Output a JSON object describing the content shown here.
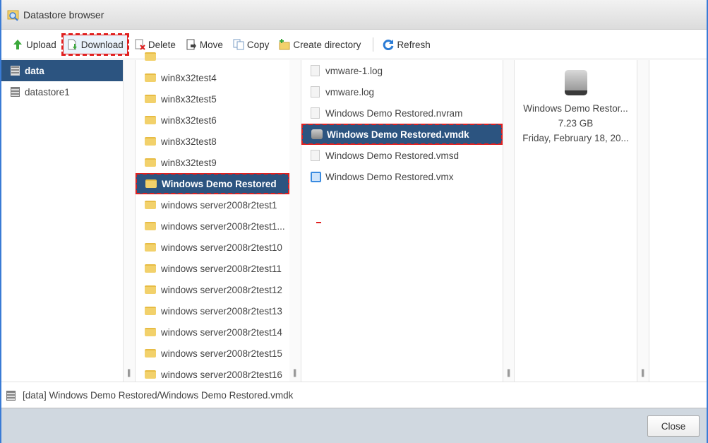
{
  "window": {
    "title": "Datastore browser"
  },
  "toolbar": {
    "upload": "Upload",
    "download": "Download",
    "delete": "Delete",
    "move": "Move",
    "copy": "Copy",
    "create_directory": "Create directory",
    "refresh": "Refresh"
  },
  "datastores": [
    {
      "label": "data",
      "selected": true
    },
    {
      "label": "datastore1",
      "selected": false
    }
  ],
  "folders": [
    {
      "label": ""
    },
    {
      "label": "win8x32test4"
    },
    {
      "label": "win8x32test5"
    },
    {
      "label": "win8x32test6"
    },
    {
      "label": "win8x32test8"
    },
    {
      "label": "win8x32test9"
    },
    {
      "label": "Windows Demo Restored",
      "selected": true
    },
    {
      "label": "windows server2008r2test1"
    },
    {
      "label": "windows server2008r2test1..."
    },
    {
      "label": "windows server2008r2test10"
    },
    {
      "label": "windows server2008r2test11"
    },
    {
      "label": "windows server2008r2test12"
    },
    {
      "label": "windows server2008r2test13"
    },
    {
      "label": "windows server2008r2test14"
    },
    {
      "label": "windows server2008r2test15"
    },
    {
      "label": "windows server2008r2test16"
    }
  ],
  "files": [
    {
      "label": "vmware-1.log",
      "icon": "file"
    },
    {
      "label": "vmware.log",
      "icon": "file"
    },
    {
      "label": "Windows Demo Restored.nvram",
      "icon": "file"
    },
    {
      "label": "Windows Demo Restored.vmdk",
      "icon": "disk",
      "selected": true
    },
    {
      "label": "Windows Demo Restored.vmsd",
      "icon": "file"
    },
    {
      "label": "Windows Demo Restored.vmx",
      "icon": "vmx"
    }
  ],
  "preview": {
    "name": "Windows Demo Restor...",
    "size": "7.23 GB",
    "date": "Friday, February 18, 20..."
  },
  "status": {
    "path": "[data] Windows Demo Restored/Windows Demo Restored.vmdk"
  },
  "footer": {
    "close": "Close"
  },
  "colors": {
    "selection": "#2c5480",
    "highlight": "#e02020"
  }
}
